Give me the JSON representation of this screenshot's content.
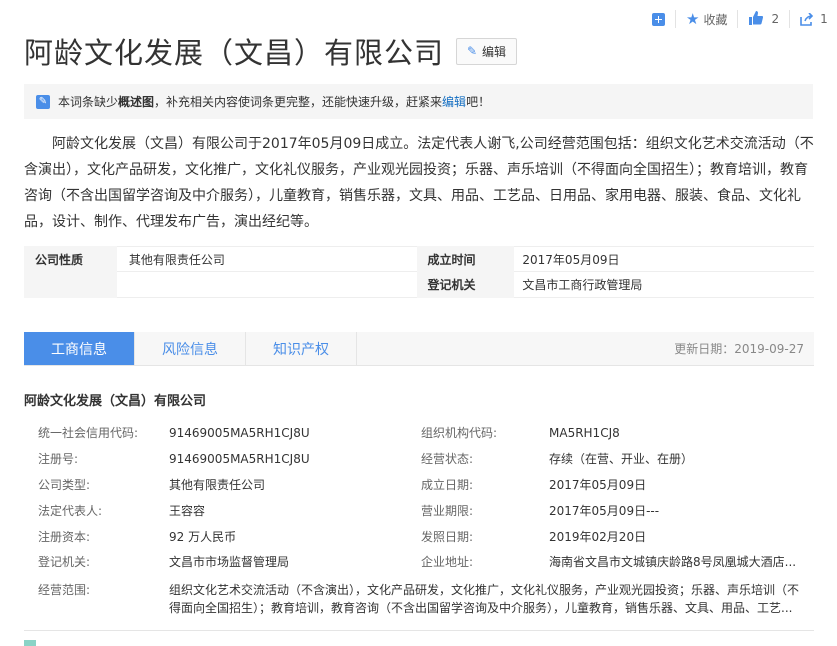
{
  "toolbar": {
    "favorite_label": "收藏",
    "like_count": "2",
    "share_count": "1"
  },
  "title": "阿龄文化发展（文昌）有限公司",
  "edit_label": "编辑",
  "notice": {
    "prefix": "本词条缺少",
    "bold": "概述图",
    "middle": "，补充相关内容使词条更完整，还能快速升级，赶紧来",
    "link": "编辑",
    "suffix": "吧！"
  },
  "summary": "阿龄文化发展（文昌）有限公司于2017年05月09日成立。法定代表人谢飞,公司经营范围包括：组织文化艺术交流活动（不含演出），文化产品研发，文化推广，文化礼仪服务，产业观光园投资；乐器、声乐培训（不得面向全国招生）；教育培训，教育咨询（不含出国留学咨询及中介服务），儿童教育，销售乐器，文具、用品、工艺品、日用品、家用电器、服装、食品、文化礼品，设计、制作、代理发布广告，演出经纪等。",
  "basic": {
    "nature_label": "公司性质",
    "nature_value": "其他有限责任公司",
    "founded_label": "成立时间",
    "founded_value": "2017年05月09日",
    "authority_label": "登记机关",
    "authority_value": "文昌市工商行政管理局"
  },
  "tabs": [
    "工商信息",
    "风险信息",
    "知识产权"
  ],
  "update_date": "更新日期：2019-09-27",
  "company_name": "阿龄文化发展（文昌）有限公司",
  "details": [
    {
      "l1": "统一社会信用代码:",
      "v1": "91469005MA5RH1CJ8U",
      "l2": "组织机构代码:",
      "v2": "MA5RH1CJ8"
    },
    {
      "l1": "注册号:",
      "v1": "91469005MA5RH1CJ8U",
      "l2": "经营状态:",
      "v2": "存续（在营、开业、在册）"
    },
    {
      "l1": "公司类型:",
      "v1": "其他有限责任公司",
      "l2": "成立日期:",
      "v2": "2017年05月09日"
    },
    {
      "l1": "法定代表人:",
      "v1": "王容容",
      "l2": "营业期限:",
      "v2": "2017年05月09日---"
    },
    {
      "l1": "注册资本:",
      "v1": "92 万人民币",
      "l2": "发照日期:",
      "v2": "2019年02月20日"
    },
    {
      "l1": "登记机关:",
      "v1": "文昌市市场监督管理局",
      "l2": "企业地址:",
      "v2": "海南省文昌市文城镇庆龄路8号凤凰城大酒店..."
    }
  ],
  "scope_label": "经营范围:",
  "scope_value": "组织文化艺术交流活动（不含演出），文化产品研发，文化推广，文化礼仪服务，产业观光园投资；乐器、声乐培训（不得面向全国招生）；教育培训，教育咨询（不含出国留学咨询及中介服务），儿童教育，销售乐器、文具、用品、工艺...",
  "colors": {
    "accent": "#4a8ee8",
    "link": "#136ec2"
  }
}
